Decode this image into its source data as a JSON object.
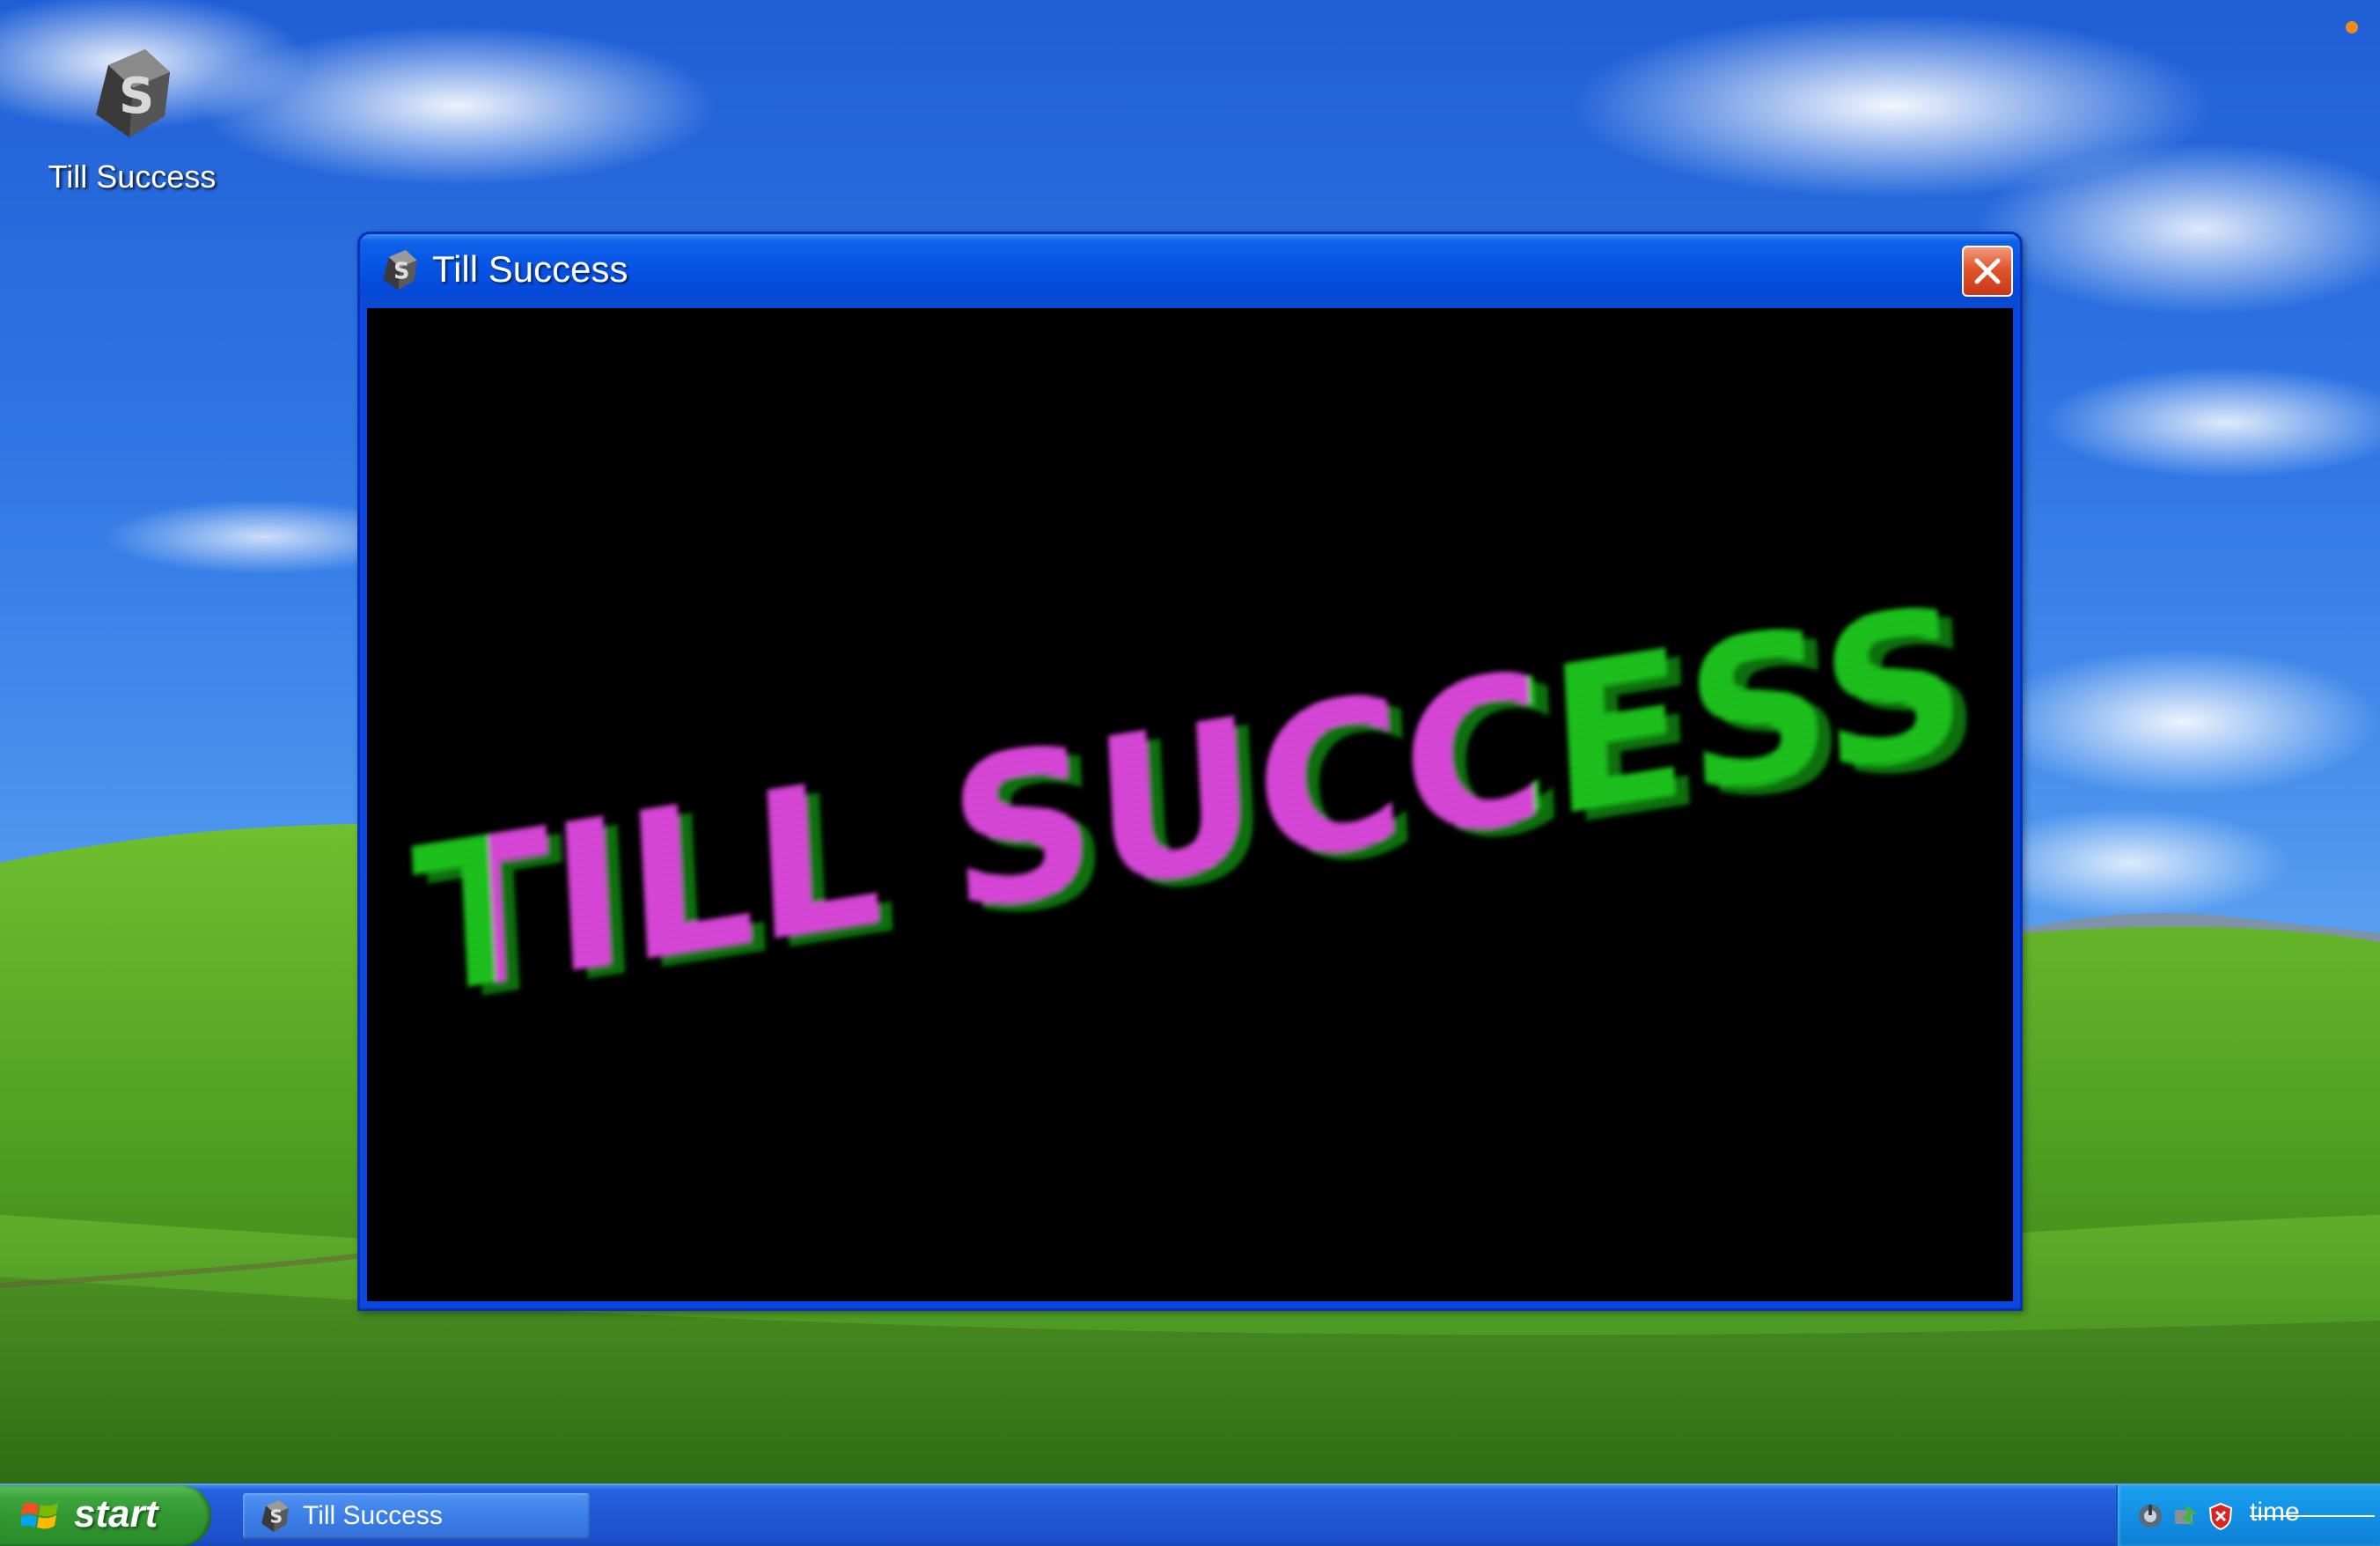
{
  "desktop": {
    "icons": [
      {
        "label": "Till Success",
        "icon": "till-success-app-icon"
      }
    ],
    "notification_dot_color": "#f08a1c"
  },
  "window": {
    "title": "Till Success",
    "icon": "till-success-app-icon",
    "close_icon": "close-icon",
    "logo_text": "TILL SUCCESS",
    "logo_colors": {
      "primary": "#ea4cea",
      "secondary": "#1fd21f"
    }
  },
  "taskbar": {
    "start_label": "start",
    "start_icon": "windows-flag-icon",
    "tasks": [
      {
        "label": "Till Success",
        "icon": "till-success-app-icon"
      }
    ],
    "tray": {
      "icons": [
        "network-icon",
        "safely-remove-hardware-icon",
        "security-shield-icon"
      ],
      "clock": "time"
    }
  }
}
